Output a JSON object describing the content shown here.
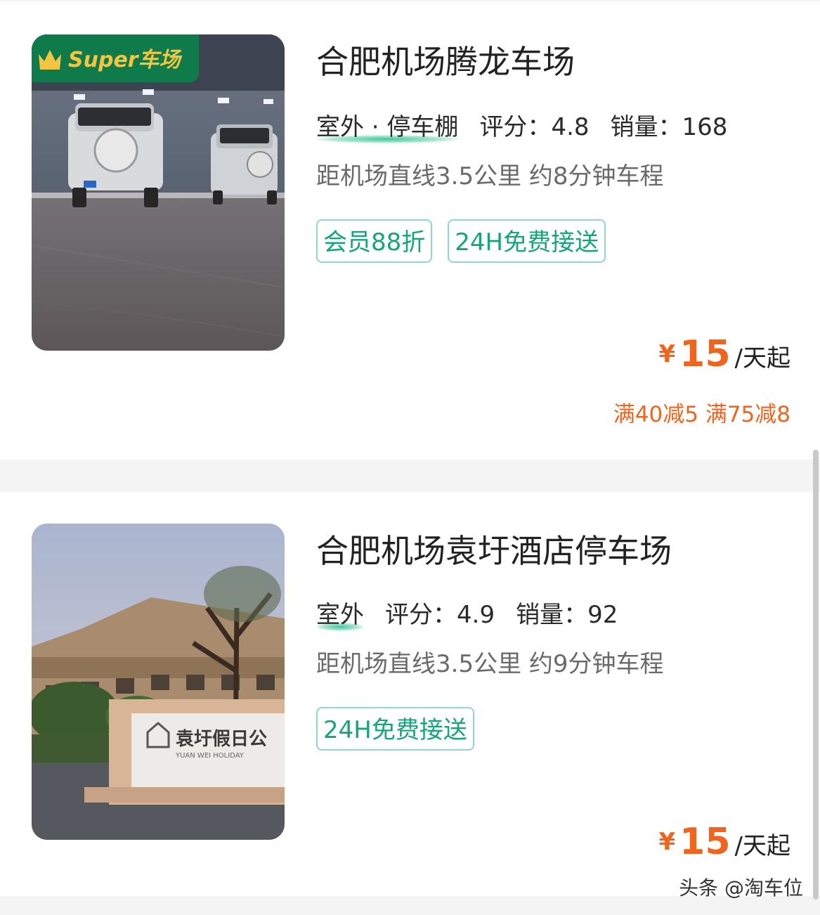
{
  "listings": [
    {
      "badge": "Super车场",
      "title": "合肥机场腾龙车场",
      "type": "室外 · 停车棚",
      "rating_label": "评分：",
      "rating": "4.8",
      "sales_label": "销量：",
      "sales": "168",
      "distance": "距机场直线3.5公里 约8分钟车程",
      "tags": [
        "会员88折",
        "24H免费接送"
      ],
      "currency": "¥",
      "price": "15",
      "price_unit": "/天起",
      "promo": "满40减5 满75减8"
    },
    {
      "title": "合肥机场袁圩酒店停车场",
      "type": "室外",
      "rating_label": "评分：",
      "rating": "4.9",
      "sales_label": "销量：",
      "sales": "92",
      "distance": "距机场直线3.5公里 约9分钟车程",
      "tags": [
        "24H免费接送"
      ],
      "currency": "¥",
      "price": "15",
      "price_unit": "/天起",
      "sign_text_cn": "袁圩假日公",
      "sign_text_en": "YUAN WEI HOLIDAY"
    }
  ],
  "watermark": "头条 @淘车位",
  "colors": {
    "accent_green": "#16a57a",
    "price_orange": "#f0651e",
    "badge_green": "#0f7a4a",
    "badge_gold": "#f5c542"
  }
}
